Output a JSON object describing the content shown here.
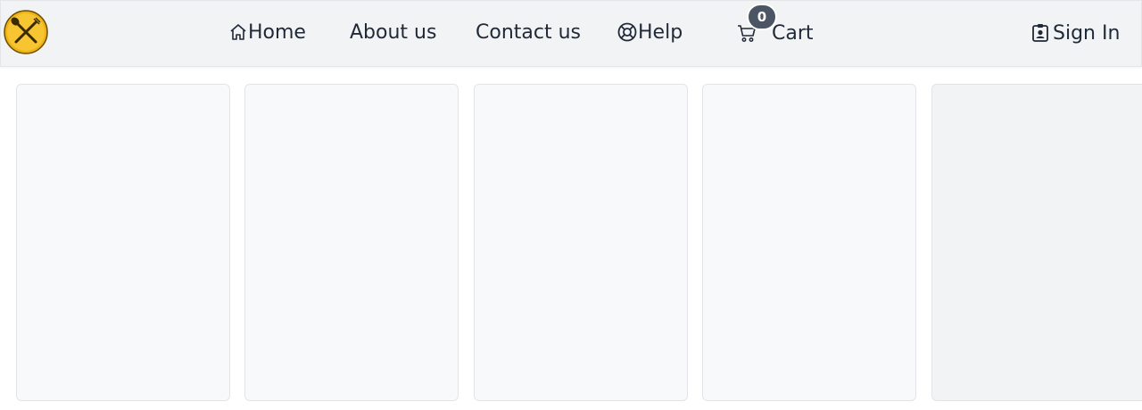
{
  "header": {
    "logo_icon": "spoon-fork-crossed-icon",
    "nav": {
      "home": {
        "label": "Home",
        "icon": "house-icon"
      },
      "about": {
        "label": "About us"
      },
      "contact": {
        "label": "Contact us"
      },
      "help": {
        "label": "Help",
        "icon": "lifebuoy-icon"
      },
      "cart": {
        "label": "Cart",
        "icon": "cart-icon",
        "count": "0"
      },
      "signin": {
        "label": "Sign In",
        "icon": "id-badge-icon"
      }
    }
  },
  "cards": [
    {
      "state": "loading"
    },
    {
      "state": "loading"
    },
    {
      "state": "loading"
    },
    {
      "state": "loading"
    },
    {
      "state": "loading"
    }
  ],
  "colors": {
    "nav_bg": "#f2f3f5",
    "text": "#1f2937",
    "badge_bg": "#4b5563",
    "logo_gold": "#f0b317"
  }
}
